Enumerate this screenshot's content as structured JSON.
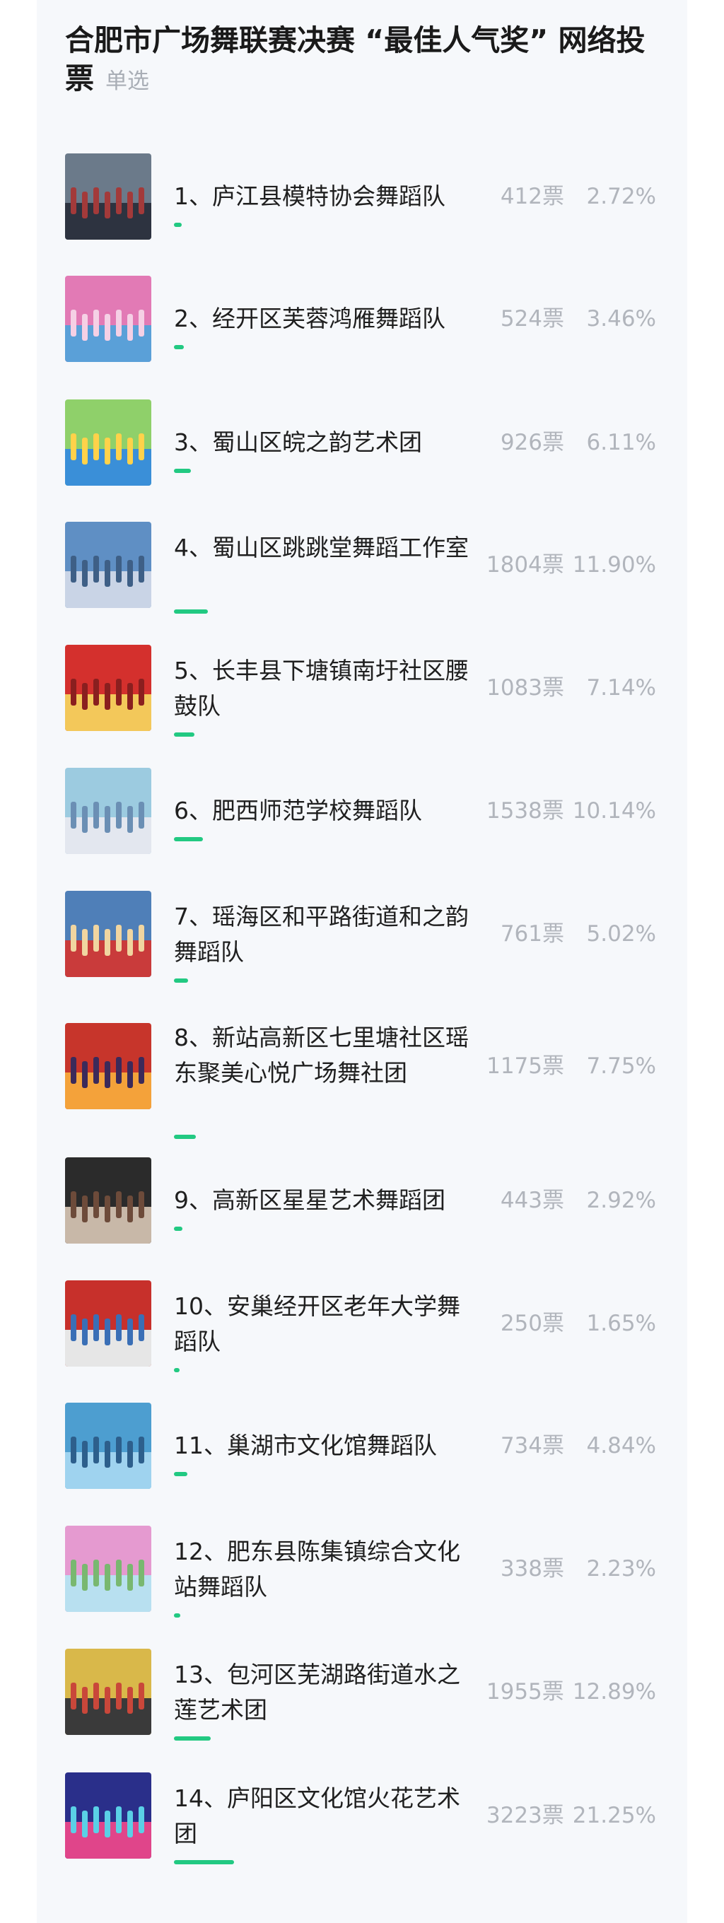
{
  "header": {
    "title": "合肥市广场舞联赛决赛 “最佳人气奖” 网络投票",
    "mode": "单选"
  },
  "vote_unit": "票",
  "colors": {
    "accent": "#22c982",
    "muted_text": "#b1b5bc",
    "title_text": "#1a1a1a"
  },
  "options": [
    {
      "label": "1、庐江县模特协会舞蹈队",
      "votes": "412票",
      "percent": "2.72%",
      "share": 0.0272,
      "photo": "outdoor-ensemble-photo"
    },
    {
      "label": "2、经开区芙蓉鸿雁舞蹈队",
      "votes": "524票",
      "percent": "3.46%",
      "share": 0.0346,
      "photo": "pink-dancers-photo"
    },
    {
      "label": "3、蜀山区皖之韵艺术团",
      "votes": "926票",
      "percent": "6.11%",
      "share": 0.0611,
      "photo": "stage-performance-photo"
    },
    {
      "label": "4、蜀山区跳跳堂舞蹈工作室",
      "votes": "1804票",
      "percent": "11.90%",
      "share": 0.119,
      "photo": "plaza-dance-photo"
    },
    {
      "label": "5、长丰县下塘镇南圩社区腰鼓队",
      "votes": "1083票",
      "percent": "7.14%",
      "share": 0.0714,
      "photo": "red-banner-group-photo"
    },
    {
      "label": "6、肥西师范学校舞蹈队",
      "votes": "1538票",
      "percent": "10.14%",
      "share": 0.1014,
      "photo": "stage-lineup-photo"
    },
    {
      "label": "7、瑶海区和平路街道和之韵舞蹈队",
      "votes": "761票",
      "percent": "5.02%",
      "share": 0.0502,
      "photo": "outdoor-red-dancers-photo"
    },
    {
      "label": "8、新站高新区七里塘社区瑶东聚美心悦广场舞社团",
      "votes": "1175票",
      "percent": "7.75%",
      "share": 0.0775,
      "photo": "red-stage-photo"
    },
    {
      "label": "9、高新区星星艺术舞蹈团",
      "votes": "443票",
      "percent": "2.92%",
      "share": 0.0292,
      "photo": "indoor-group-photo"
    },
    {
      "label": "10、安巢经开区老年大学舞蹈队",
      "votes": "250票",
      "percent": "1.65%",
      "share": 0.0165,
      "photo": "event-stage-photo"
    },
    {
      "label": "11、巢湖市文化馆舞蹈队",
      "votes": "734票",
      "percent": "4.84%",
      "share": 0.0484,
      "photo": "blue-costume-dancers-photo"
    },
    {
      "label": "12、肥东县陈集镇综合文化站舞蹈队",
      "votes": "338票",
      "percent": "2.23%",
      "share": 0.0223,
      "photo": "outdoor-fan-dance-photo"
    },
    {
      "label": "13、包河区芜湖路街道水之莲艺术团",
      "votes": "1955票",
      "percent": "12.89%",
      "share": 0.1289,
      "photo": "yellow-costume-stage-photo"
    },
    {
      "label": "14、庐阳区文化馆火花艺术团",
      "votes": "3223票",
      "percent": "21.25%",
      "share": 0.2125,
      "photo": "night-stage-photo"
    }
  ]
}
